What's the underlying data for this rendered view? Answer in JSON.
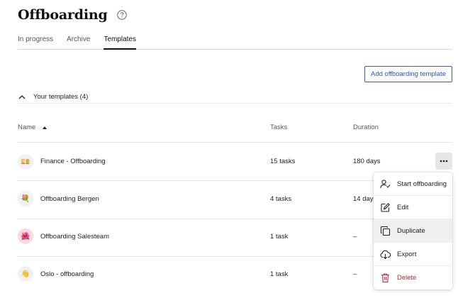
{
  "page": {
    "title": "Offboarding"
  },
  "tabs": [
    {
      "label": "In progress"
    },
    {
      "label": "Archive"
    },
    {
      "label": "Templates"
    }
  ],
  "add_button": {
    "label": "Add offboarding template"
  },
  "section": {
    "label": "Your templates (4)"
  },
  "table": {
    "headers": {
      "name": "Name",
      "tasks": "Tasks",
      "duration": "Duration"
    },
    "rows": [
      {
        "name": "Finance - Offboarding",
        "tasks": "15 tasks",
        "duration": "180 days",
        "emoji": "💴",
        "avatar_bg": "#f1f1f1"
      },
      {
        "name": "Offboarding Bergen",
        "tasks": "4 tasks",
        "duration": "14 days",
        "emoji": "💐",
        "avatar_bg": "#f1f1f1"
      },
      {
        "name": "Offboarding Salesteam",
        "tasks": "1 task",
        "duration": "–",
        "emoji": "🌺",
        "avatar_bg": "#f8d9de"
      },
      {
        "name": "Oslo - offboarding",
        "tasks": "1 task",
        "duration": "–",
        "emoji": "👋",
        "avatar_bg": "#f1f1f1"
      }
    ]
  },
  "context_menu": {
    "items": [
      {
        "label": "Start offboarding",
        "icon": "user-check-icon"
      },
      {
        "label": "Edit",
        "icon": "edit-icon"
      },
      {
        "label": "Duplicate",
        "icon": "duplicate-icon"
      },
      {
        "label": "Export",
        "icon": "export-icon"
      },
      {
        "label": "Delete",
        "icon": "trash-icon"
      }
    ]
  },
  "colors": {
    "accent": "#2d56b8",
    "danger": "#c0283b",
    "hover": "#f0f0f0"
  }
}
